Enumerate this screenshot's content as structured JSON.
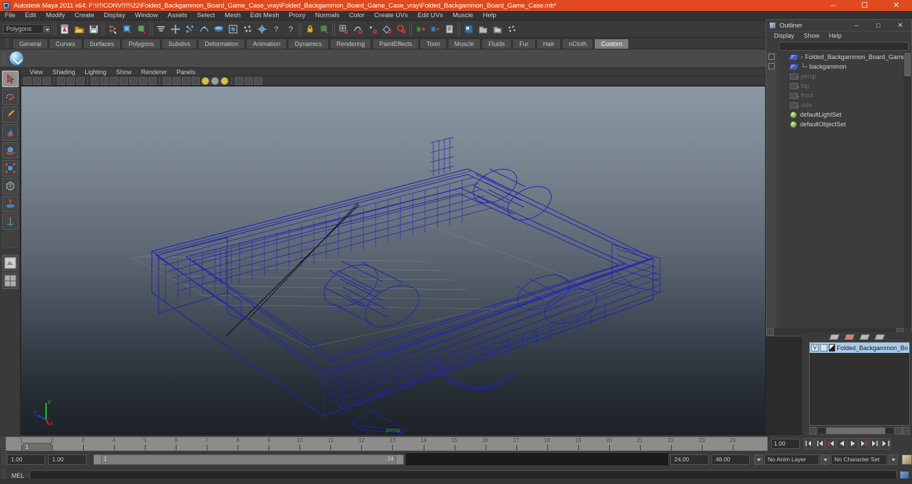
{
  "window": {
    "title": "Autodesk Maya 2011 x64: F:\\!!!!CONV!!!!!\\22\\Folded_Backgammon_Board_Game_Case_vray\\Folded_Backgammon_Board_Game_Case_vray\\Folded_Backgammon_Board_Game_Case.mb*",
    "icon": "maya-app-icon",
    "minimize": "–",
    "maximize": "☐",
    "close": "✕",
    "titlebar_color": "#e04a1f"
  },
  "menubar": {
    "items": [
      {
        "label": "File"
      },
      {
        "label": "Edit"
      },
      {
        "label": "Modify"
      },
      {
        "label": "Create"
      },
      {
        "label": "Display"
      },
      {
        "label": "Window"
      },
      {
        "label": "Assets"
      },
      {
        "label": "Select"
      },
      {
        "label": "Mesh"
      },
      {
        "label": "Edit Mesh"
      },
      {
        "label": "Proxy"
      },
      {
        "label": "Normals"
      },
      {
        "label": "Color"
      },
      {
        "label": "Create UVs"
      },
      {
        "label": "Edit UVs"
      },
      {
        "label": "Muscle"
      },
      {
        "label": "Help"
      }
    ]
  },
  "statusline": {
    "menu_set": "Polygons",
    "buttons": [
      {
        "name": "new-scene-icon"
      },
      {
        "name": "open-scene-icon"
      },
      {
        "name": "save-scene-icon"
      },
      {
        "name": "select-by-hierarchy-icon"
      },
      {
        "name": "select-by-object-type-icon"
      },
      {
        "name": "select-by-component-type-icon"
      },
      {
        "name": "component-mask-icon"
      },
      {
        "name": "handles-mask-icon"
      },
      {
        "name": "points-mask-icon"
      },
      {
        "name": "parm-points-mask-icon"
      },
      {
        "name": "surfaces-mask-icon"
      },
      {
        "name": "deformations-mask-icon"
      },
      {
        "name": "dynamics-mask-icon"
      },
      {
        "name": "rendering-mask-icon"
      },
      {
        "name": "misc-mask-icon"
      },
      {
        "name": "help-icon"
      },
      {
        "name": "lock-icon"
      },
      {
        "name": "highlight-selection-icon"
      },
      {
        "name": "snap-to-grid-icon"
      },
      {
        "name": "snap-to-curve-icon"
      },
      {
        "name": "snap-to-point-icon"
      },
      {
        "name": "snap-to-projected-center-icon"
      },
      {
        "name": "snap-to-view-plane-icon"
      },
      {
        "name": "construction-history-input-icon"
      },
      {
        "name": "construction-history-output-icon"
      },
      {
        "name": "construction-history-toggle-icon"
      },
      {
        "name": "render-current-frame-icon"
      },
      {
        "name": "ipr-render-icon"
      },
      {
        "name": "render-settings-icon"
      },
      {
        "name": "render-globals-icon"
      }
    ]
  },
  "shelf": {
    "tabs": [
      {
        "label": "General",
        "active": false
      },
      {
        "label": "Curves",
        "active": false
      },
      {
        "label": "Surfaces",
        "active": false
      },
      {
        "label": "Polygons",
        "active": false
      },
      {
        "label": "Subdivs",
        "active": false
      },
      {
        "label": "Deformation",
        "active": false
      },
      {
        "label": "Animation",
        "active": false
      },
      {
        "label": "Dynamics",
        "active": false
      },
      {
        "label": "Rendering",
        "active": false
      },
      {
        "label": "PaintEffects",
        "active": false
      },
      {
        "label": "Toon",
        "active": false
      },
      {
        "label": "Muscle",
        "active": false
      },
      {
        "label": "Fluids",
        "active": false
      },
      {
        "label": "Fur",
        "active": false
      },
      {
        "label": "Hair",
        "active": false
      },
      {
        "label": "nCloth",
        "active": false
      },
      {
        "label": "Custom",
        "active": true
      }
    ],
    "icons": [
      {
        "name": "vray-render-shelf-icon"
      }
    ]
  },
  "toolbox": {
    "tools": [
      {
        "name": "select-tool-icon",
        "selected": true
      },
      {
        "name": "lasso-select-tool-icon",
        "selected": false
      },
      {
        "name": "paint-select-tool-icon",
        "selected": false
      },
      {
        "name": "move-tool-icon",
        "selected": false
      },
      {
        "name": "rotate-tool-icon",
        "selected": false
      },
      {
        "name": "scale-tool-icon",
        "selected": false
      },
      {
        "name": "universal-manipulator-icon",
        "selected": false
      },
      {
        "name": "soft-modification-tool-icon",
        "selected": false
      },
      {
        "name": "last-tool-used-icon",
        "selected": false
      }
    ],
    "layouts": [
      {
        "name": "single-perspective-layout-icon"
      },
      {
        "name": "four-view-layout-icon"
      }
    ]
  },
  "viewport": {
    "menu": [
      {
        "label": "View"
      },
      {
        "label": "Shading"
      },
      {
        "label": "Lighting"
      },
      {
        "label": "Show"
      },
      {
        "label": "Renderer"
      },
      {
        "label": "Panels"
      }
    ],
    "camera_label": "persp",
    "camera_label_color": "#2aa62a",
    "wireframe_color": "#1f25b4",
    "axis_gizmo": {
      "x": "X",
      "y": "Y",
      "z": "Z",
      "x_color": "#e02020",
      "y_color": "#20c020",
      "z_color": "#2040e0"
    },
    "shading_mode": "wireframe",
    "background": "gradient-blue-grey"
  },
  "outliner": {
    "title": "Outliner",
    "window_buttons": {
      "minimize": "–",
      "maximize": "□",
      "close": "✕"
    },
    "menu": [
      {
        "label": "Display"
      },
      {
        "label": "Show"
      },
      {
        "label": "Help"
      }
    ],
    "search_value": "",
    "items": [
      {
        "label": "Folded_Backgammon_Board_Game_Case",
        "icon": "transform-node-icon",
        "indent": 0,
        "expandable": true,
        "dim": false
      },
      {
        "label": "backgammon",
        "icon": "transform-node-icon",
        "indent": 1,
        "expandable": true,
        "dim": false
      },
      {
        "label": "persp",
        "icon": "camera-node-icon",
        "indent": 0,
        "expandable": false,
        "dim": true
      },
      {
        "label": "top",
        "icon": "camera-node-icon",
        "indent": 0,
        "expandable": false,
        "dim": true
      },
      {
        "label": "front",
        "icon": "camera-node-icon",
        "indent": 0,
        "expandable": false,
        "dim": true
      },
      {
        "label": "side",
        "icon": "camera-node-icon",
        "indent": 0,
        "expandable": false,
        "dim": true
      },
      {
        "label": "defaultLightSet",
        "icon": "set-node-icon",
        "indent": 0,
        "expandable": false,
        "dim": false
      },
      {
        "label": "defaultObjectSet",
        "icon": "set-node-icon",
        "indent": 0,
        "expandable": false,
        "dim": false
      }
    ]
  },
  "layer_editor": {
    "tab_icons": [
      {
        "name": "display-layer-tab-icon",
        "active": false
      },
      {
        "name": "render-layer-tab-icon",
        "active": true
      },
      {
        "name": "anim-layer-tab-icon",
        "active": false
      },
      {
        "name": "layer-extra-tab-icon",
        "active": false
      }
    ],
    "layers": [
      {
        "visibility": "V",
        "playback": "",
        "name": "Folded_Backgammon_Bo",
        "selected": true
      }
    ]
  },
  "timeline": {
    "start": 1,
    "end": 24,
    "current_frame": "1",
    "ticks": [
      1,
      2,
      3,
      4,
      5,
      6,
      7,
      8,
      9,
      10,
      11,
      12,
      13,
      14,
      15,
      16,
      17,
      18,
      19,
      20,
      21,
      22,
      23,
      24
    ],
    "current_frame_field": "1.00",
    "playback_buttons": [
      {
        "name": "go-to-start-button"
      },
      {
        "name": "step-back-frame-button"
      },
      {
        "name": "step-back-key-button"
      },
      {
        "name": "play-backwards-button"
      },
      {
        "name": "play-forwards-button"
      },
      {
        "name": "step-forward-key-button"
      },
      {
        "name": "step-forward-frame-button"
      },
      {
        "name": "go-to-end-button"
      }
    ]
  },
  "range_slider": {
    "anim_start": "1.00",
    "range_start": "1.00",
    "slider_min": "1",
    "slider_max": "24",
    "range_end": "24.00",
    "anim_end": "48.00",
    "anim_layer": "No Anim Layer",
    "character_set": "No Character Set"
  },
  "command_line": {
    "language": "MEL",
    "value": "",
    "placeholder": ""
  }
}
